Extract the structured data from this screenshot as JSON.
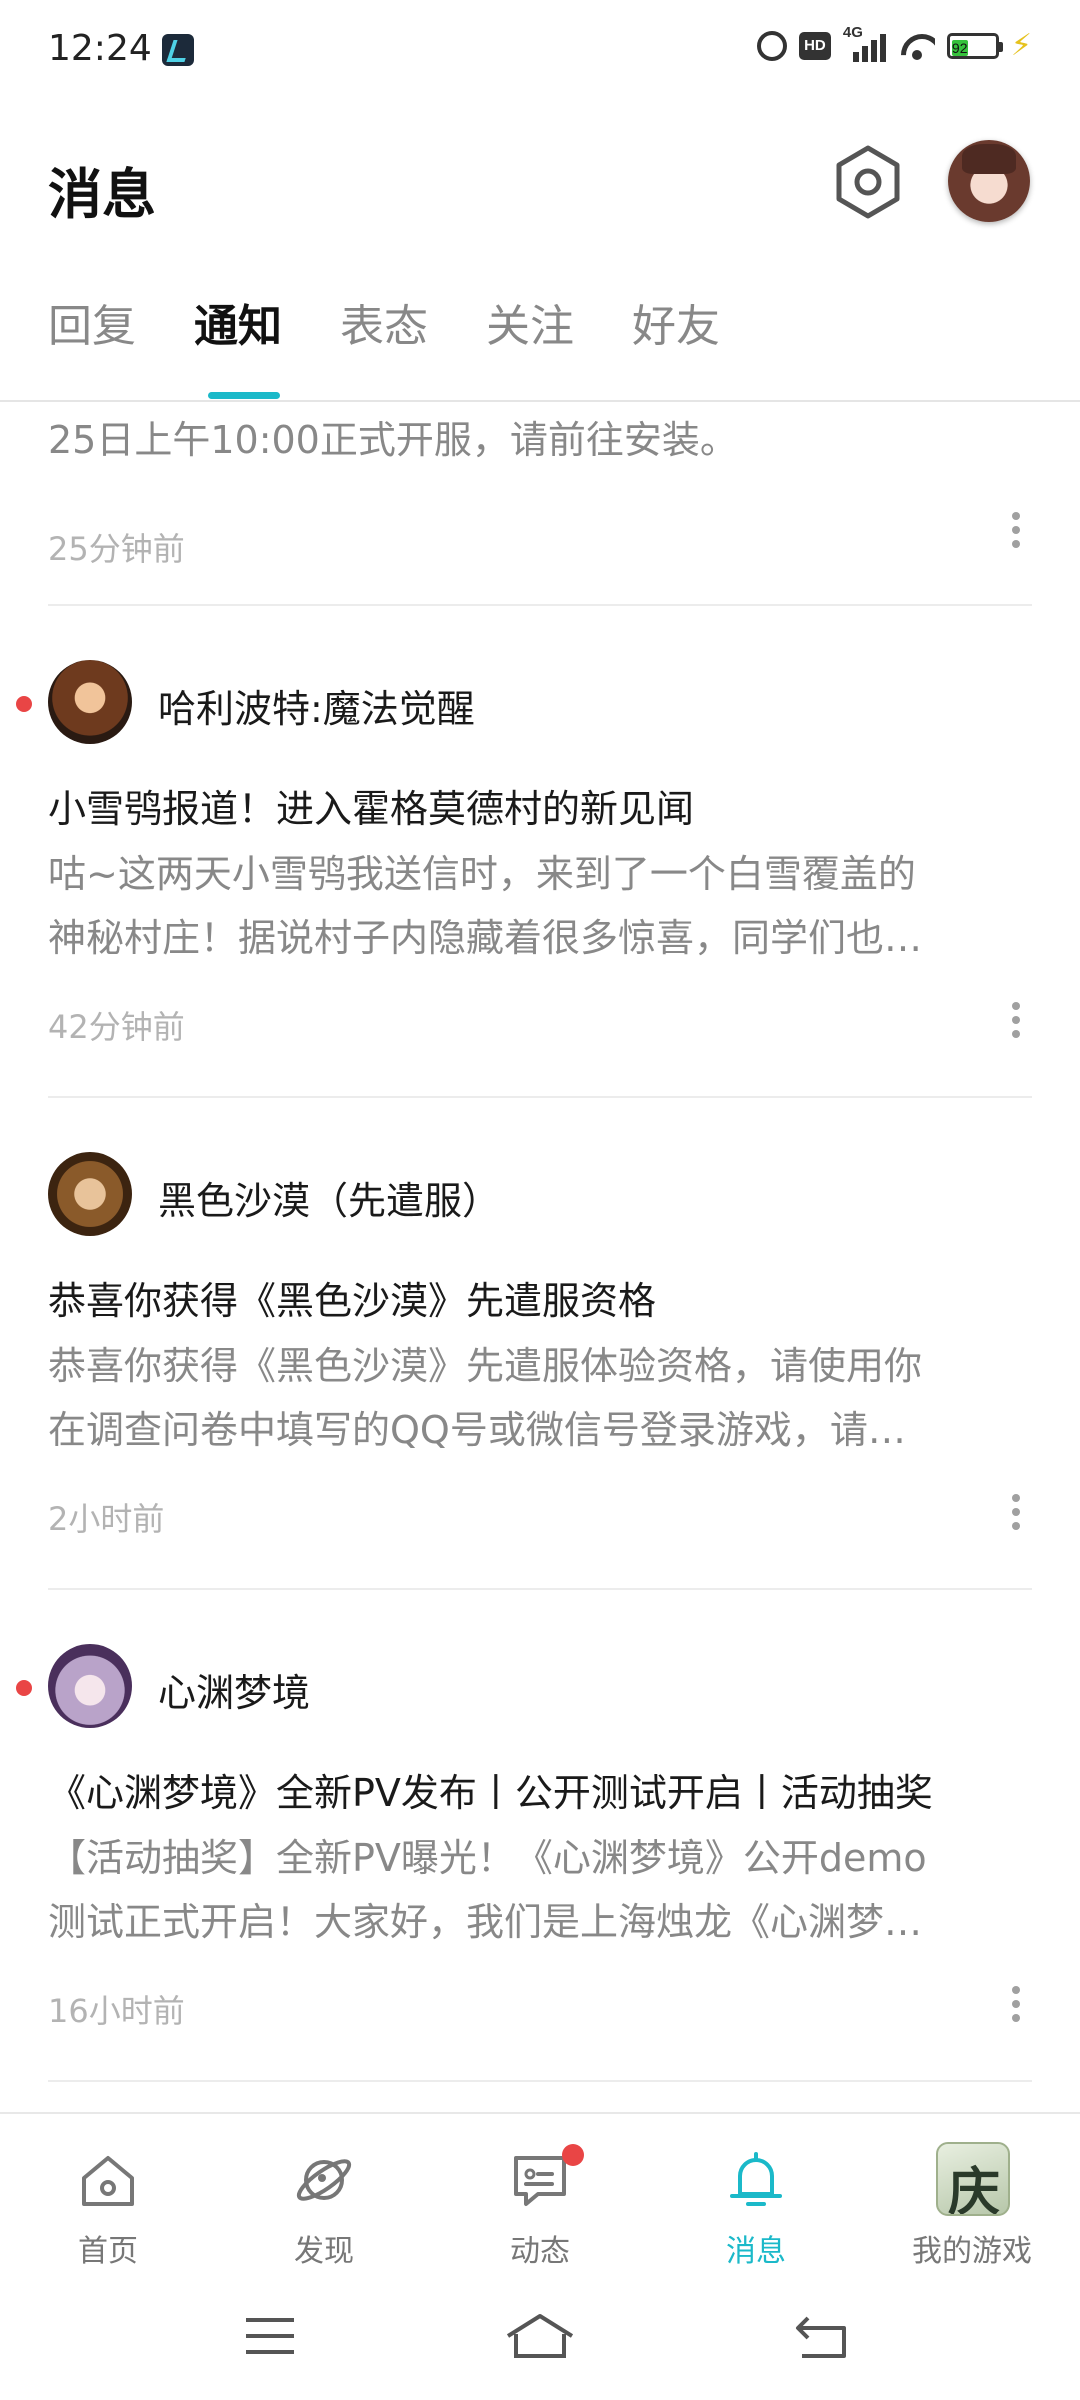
{
  "status_bar": {
    "time": "12:24",
    "network": "4G",
    "hd": "HD",
    "battery": "92",
    "icons": [
      "app-icon",
      "alarm-icon",
      "hd-icon",
      "signal-icon",
      "wifi-icon",
      "battery-icon",
      "charging-icon"
    ]
  },
  "header": {
    "title": "消息"
  },
  "tabs": [
    {
      "label": "回复"
    },
    {
      "label": "通知",
      "active": true
    },
    {
      "label": "表态"
    },
    {
      "label": "关注"
    },
    {
      "label": "好友"
    }
  ],
  "feed": {
    "partial_item": {
      "body": "25日上午10:00正式开服，请前往安装。",
      "time": "25分钟前"
    },
    "items": [
      {
        "name": "哈利波特:魔法觉醒",
        "unread": true,
        "title": "小雪鸮报道！进入霍格莫德村的新见闻",
        "body_lines": [
          "咕~这两天小雪鸮我送信时，来到了一个白雪覆盖的",
          "神秘村庄！据说村子内隐藏着很多惊喜，同学们也…"
        ],
        "time": "42分钟前"
      },
      {
        "name": "黑色沙漠（先遣服）",
        "unread": false,
        "title": "恭喜你获得《黑色沙漠》先遣服资格",
        "body_lines": [
          "恭喜你获得《黑色沙漠》先遣服体验资格，请使用你",
          "在调查问卷中填写的QQ号或微信号登录游戏，请…"
        ],
        "time": "2小时前"
      },
      {
        "name": "心渊梦境",
        "unread": true,
        "title": "《心渊梦境》全新PV发布丨公开测试开启丨活动抽奖",
        "body_lines": [
          "【活动抽奖】全新PV曝光！《心渊梦境》公开demo",
          "测试正式开启！大家好，我们是上海烛龙《心渊梦…"
        ],
        "time": "16小时前"
      }
    ]
  },
  "bottom_nav": {
    "items": [
      {
        "label": "首页",
        "icon": "home-icon"
      },
      {
        "label": "发现",
        "icon": "planet-icon"
      },
      {
        "label": "动态",
        "icon": "chat-icon",
        "badge": true
      },
      {
        "label": "消息",
        "icon": "bell-icon",
        "active": true
      },
      {
        "label": "我的游戏",
        "icon": "game-app-icon"
      }
    ]
  },
  "colors": {
    "accent": "#1bb9c9",
    "unread": "#e94545",
    "muted_text": "#888888",
    "time_text": "#b3b3b3"
  }
}
